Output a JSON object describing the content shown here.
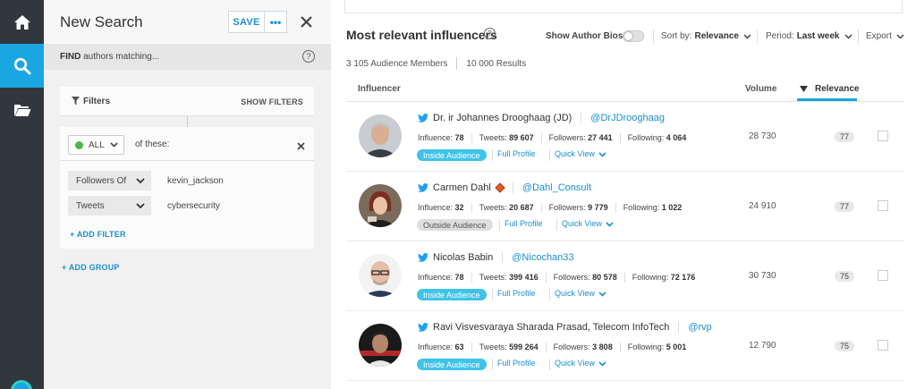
{
  "panel": {
    "title": "New Search",
    "save_label": "SAVE",
    "more_label": "•••",
    "find_bold": "FIND",
    "find_rest": " authors matching...",
    "help_label": "?",
    "filters_label": "Filters",
    "show_filters_label": "SHOW FILTERS",
    "group": {
      "match_mode": "ALL",
      "of_these": "of these:",
      "filters": [
        {
          "type": "Followers Of",
          "value": "kevin_jackson"
        },
        {
          "type": "Tweets",
          "value": "cybersecurity"
        }
      ],
      "add_filter_label": "ADD FILTER"
    },
    "add_group_label": "ADD GROUP"
  },
  "main": {
    "title": "Most relevant influencers",
    "help_label": "?",
    "show_bios_label": "Show Author Bios",
    "sort_by_label": "Sort by:",
    "sort_by_value": "Relevance",
    "period_label": "Period:",
    "period_value": "Last week",
    "export_label": "Export",
    "audience_members": "3 105 Audience Members",
    "results_count": "10 000 Results",
    "columns": {
      "influencer": "Influencer",
      "volume": "Volume",
      "relevance": "Relevance"
    },
    "stat_labels": {
      "influence": "Influence:",
      "tweets": "Tweets:",
      "followers": "Followers:",
      "following": "Following:"
    },
    "full_profile_label": "Full Profile",
    "quick_view_label": "Quick View",
    "rows": [
      {
        "name": "Dr. ir Johannes Drooghaag (JD)",
        "handle": "@DrJDrooghaag",
        "influence": "78",
        "tweets": "89 607",
        "followers": "27 441",
        "following": "4 064",
        "audience": "Inside Audience",
        "volume": "28 730",
        "relevance": "77"
      },
      {
        "name": "Carmen Dahl",
        "handle": "@Dahl_Consult",
        "influence": "32",
        "tweets": "20 687",
        "followers": "9 779",
        "following": "1 022",
        "audience": "Outside Audience",
        "volume": "24 910",
        "relevance": "77"
      },
      {
        "name": "Nicolas Babin",
        "handle": "@Nicochan33",
        "influence": "78",
        "tweets": "399 416",
        "followers": "80 578",
        "following": "72 176",
        "audience": "Inside Audience",
        "volume": "30 730",
        "relevance": "75"
      },
      {
        "name": "Ravi Visvesvaraya Sharada Prasad, Telecom InfoTech",
        "handle": "@rvp",
        "influence": "63",
        "tweets": "599 264",
        "followers": "3 808",
        "following": "5 001",
        "audience": "Inside Audience",
        "volume": "12 790",
        "relevance": "75"
      }
    ]
  },
  "colors": {
    "accent": "#1aa6e0",
    "link": "#1a8fd0",
    "rail": "#31373d",
    "inside_badge": "#3fc3e8",
    "active_dot": "#4cb849"
  }
}
